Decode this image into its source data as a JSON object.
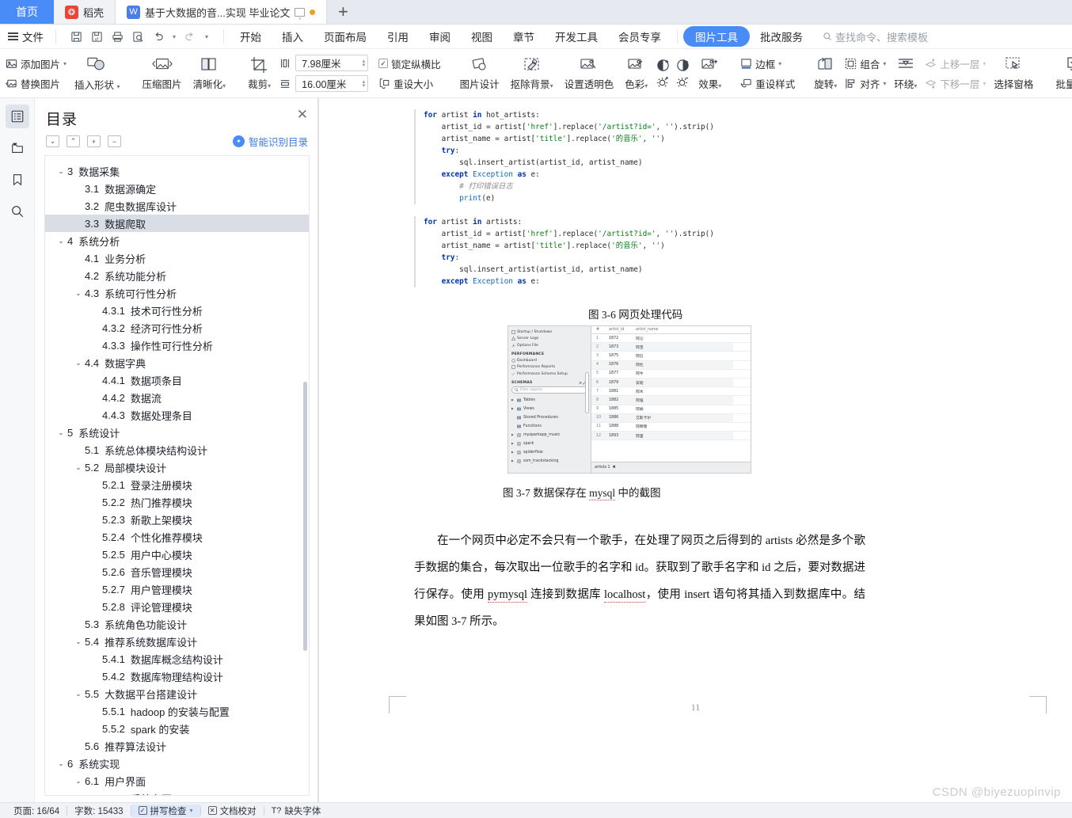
{
  "tabs": {
    "home_label": "首页",
    "docer_label": "稻壳",
    "doc_label": "基于大数据的音...实现 毕业论文",
    "new_tab_label": "+"
  },
  "menubar": {
    "file_label": "文件",
    "quick_access": [
      "save-icon",
      "save-as-icon",
      "print-icon",
      "print-preview-icon",
      "undo-icon",
      "redo-icon",
      "customize-icon"
    ],
    "items": [
      {
        "label": "开始",
        "active": false
      },
      {
        "label": "插入",
        "active": false
      },
      {
        "label": "页面布局",
        "active": false
      },
      {
        "label": "引用",
        "active": false
      },
      {
        "label": "审阅",
        "active": false
      },
      {
        "label": "视图",
        "active": false
      },
      {
        "label": "章节",
        "active": false
      },
      {
        "label": "开发工具",
        "active": false
      },
      {
        "label": "会员专享",
        "active": false
      },
      {
        "label": "图片工具",
        "active": true
      },
      {
        "label": "批改服务",
        "active": false
      }
    ],
    "search_placeholder": "查找命令、搜索模板",
    "accent_color": "#4a8cf7"
  },
  "ribbon": {
    "add_picture": "添加图片",
    "replace_picture": "替换图片",
    "insert_shape": "插入形状",
    "compress_picture": "压缩图片",
    "sharpen": "清晰化",
    "crop": "裁剪",
    "width_value": "7.98厘米",
    "height_value": "16.00厘米",
    "lock_aspect": "锁定纵横比",
    "lock_aspect_checked": true,
    "reset_size": "重设大小",
    "picture_design": "图片设计",
    "remove_background": "抠除背景",
    "set_transparent_color": "设置透明色",
    "color": "色彩",
    "brightness_up": "增加亮度",
    "brightness_down": "降低亮度",
    "effects": "效果",
    "reset_style": "重设样式",
    "border": "边框",
    "rotate": "旋转",
    "group": "组合",
    "align": "对齐",
    "wrap": "环绕",
    "bring_forward": "上移一层",
    "send_backward": "下移一层",
    "selection_pane": "选择窗格",
    "batch_process": "批量处理"
  },
  "rail": {
    "items": [
      {
        "name": "outline-icon",
        "selected": true
      },
      {
        "name": "thumbnail-icon",
        "selected": false
      },
      {
        "name": "bookmark-icon",
        "selected": false
      },
      {
        "name": "search-icon",
        "selected": false
      }
    ]
  },
  "outline": {
    "title": "目录",
    "close_label": "✕",
    "tools": [
      "expand-down",
      "collapse-up",
      "expand-all",
      "collapse-all"
    ],
    "smart_label": "智能识别目录",
    "items": [
      {
        "chev": "v",
        "num": "3",
        "text": "数据采集",
        "indent": 0,
        "hl": false
      },
      {
        "chev": "",
        "num": "3.1",
        "text": "数据源确定",
        "indent": 1,
        "hl": false
      },
      {
        "chev": "",
        "num": "3.2",
        "text": "爬虫数据库设计",
        "indent": 1,
        "hl": false
      },
      {
        "chev": "",
        "num": "3.3",
        "text": "数据爬取",
        "indent": 1,
        "hl": true
      },
      {
        "chev": "v",
        "num": "4",
        "text": "系统分析",
        "indent": 0,
        "hl": false
      },
      {
        "chev": "",
        "num": "4.1",
        "text": "业务分析",
        "indent": 1,
        "hl": false
      },
      {
        "chev": "",
        "num": "4.2",
        "text": "系统功能分析",
        "indent": 1,
        "hl": false
      },
      {
        "chev": "v",
        "num": "4.3",
        "text": "系统可行性分析",
        "indent": 1,
        "hl": false
      },
      {
        "chev": "",
        "num": "4.3.1",
        "text": "技术可行性分析",
        "indent": 2,
        "hl": false
      },
      {
        "chev": "",
        "num": "4.3.2",
        "text": "经济可行性分析",
        "indent": 2,
        "hl": false
      },
      {
        "chev": "",
        "num": "4.3.3",
        "text": "操作性可行性分析",
        "indent": 2,
        "hl": false
      },
      {
        "chev": "v",
        "num": "4.4",
        "text": "数据字典",
        "indent": 1,
        "hl": false
      },
      {
        "chev": "",
        "num": "4.4.1",
        "text": "数据项条目",
        "indent": 2,
        "hl": false
      },
      {
        "chev": "",
        "num": "4.4.2",
        "text": "数据流",
        "indent": 2,
        "hl": false
      },
      {
        "chev": "",
        "num": "4.4.3",
        "text": "数据处理条目",
        "indent": 2,
        "hl": false
      },
      {
        "chev": "v",
        "num": "5",
        "text": "系统设计",
        "indent": 0,
        "hl": false
      },
      {
        "chev": "",
        "num": "5.1",
        "text": "系统总体模块结构设计",
        "indent": 1,
        "hl": false
      },
      {
        "chev": "v",
        "num": "5.2",
        "text": "局部模块设计",
        "indent": 1,
        "hl": false
      },
      {
        "chev": "",
        "num": "5.2.1",
        "text": "登录注册模块",
        "indent": 2,
        "hl": false
      },
      {
        "chev": "",
        "num": "5.2.2",
        "text": "热门推荐模块",
        "indent": 2,
        "hl": false
      },
      {
        "chev": "",
        "num": "5.2.3",
        "text": "新歌上架模块",
        "indent": 2,
        "hl": false
      },
      {
        "chev": "",
        "num": "5.2.4",
        "text": "个性化推荐模块",
        "indent": 2,
        "hl": false
      },
      {
        "chev": "",
        "num": "5.2.5",
        "text": "用户中心模块",
        "indent": 2,
        "hl": false
      },
      {
        "chev": "",
        "num": "5.2.6",
        "text": "音乐管理模块",
        "indent": 2,
        "hl": false
      },
      {
        "chev": "",
        "num": "5.2.7",
        "text": "用户管理模块",
        "indent": 2,
        "hl": false
      },
      {
        "chev": "",
        "num": "5.2.8",
        "text": "评论管理模块",
        "indent": 2,
        "hl": false
      },
      {
        "chev": "",
        "num": "5.3",
        "text": "系统角色功能设计",
        "indent": 1,
        "hl": false
      },
      {
        "chev": "v",
        "num": "5.4",
        "text": "推荐系统数据库设计",
        "indent": 1,
        "hl": false
      },
      {
        "chev": "",
        "num": "5.4.1",
        "text": "数据库概念结构设计",
        "indent": 2,
        "hl": false
      },
      {
        "chev": "",
        "num": "5.4.2",
        "text": "数据库物理结构设计",
        "indent": 2,
        "hl": false
      },
      {
        "chev": "v",
        "num": "5.5",
        "text": "大数据平台搭建设计",
        "indent": 1,
        "hl": false
      },
      {
        "chev": "",
        "num": "5.5.1",
        "text": "hadoop 的安装与配置",
        "indent": 2,
        "hl": false
      },
      {
        "chev": "",
        "num": "5.5.2",
        "text": "spark 的安装",
        "indent": 2,
        "hl": false
      },
      {
        "chev": "",
        "num": "5.6",
        "text": "推荐算法设计",
        "indent": 1,
        "hl": false
      },
      {
        "chev": "v",
        "num": "6",
        "text": "系统实现",
        "indent": 0,
        "hl": false
      },
      {
        "chev": "v",
        "num": "6.1",
        "text": "用户界面",
        "indent": 1,
        "hl": false
      },
      {
        "chev": "",
        "num": "6.1.1",
        "text": "系统主页",
        "indent": 2,
        "hl": false
      }
    ]
  },
  "document": {
    "code_block_1": [
      "for artist in hot_artists:",
      "    artist_id = artist['href'].replace('/artist?id=', '').strip()",
      "    artist_name = artist['title'].replace('的音乐', '')",
      "    try:",
      "        sql.insert_artist(artist_id, artist_name)",
      "    except Exception as e:",
      "        # 打印错误日志",
      "        print(e)"
    ],
    "code_block_2": [
      "for artist in artists:",
      "    artist_id = artist['href'].replace('/artist?id=', '').strip()",
      "    artist_name = artist['title'].replace('的音乐', '')",
      "    try:",
      "        sql.insert_artist(artist_id, artist_name)",
      "    except Exception as e:"
    ],
    "figure_caption_1": "图 3-6 网页处理代码",
    "figure_caption_2": "图 3-7 数据保存在 mysql 中的截图",
    "paragraph": "在一个网页中必定不会只有一个歌手，在处理了网页之后得到的 artists 必然是多个歌手数据的集合，每次取出一位歌手的名字和 id。获取到了歌手名字和 id 之后，要对数据进行保存。使用 pymysql 连接到数据库 localhost，使用 insert 语句将其插入到数据库中。结果如图 3-7 所示。",
    "page_number": "11"
  },
  "screenshot": {
    "left_panel": {
      "top_items": [
        "Startup / Shutdown",
        "Server Logs",
        "Options File"
      ],
      "performance_header": "PERFORMANCE",
      "performance_items": [
        "Dashboard",
        "Performance Reports",
        "Performance Schema Setup"
      ],
      "schemas_header": "SCHEMAS",
      "filter_placeholder": "Filter objects",
      "tree": [
        "Tables",
        "Views",
        "Stored Procedures",
        "Functions",
        "mysparkapp_music",
        "spark",
        "spiderflow",
        "ssm_trackstacking"
      ]
    },
    "table": {
      "headers": [
        "#",
        "artist_id",
        "artist_name"
      ],
      "rows": [
        [
          "1",
          "1872",
          "阿沁"
        ],
        [
          "2",
          "1873",
          "阿宝"
        ],
        [
          "3",
          "1875",
          "阿信"
        ],
        [
          "4",
          "1876",
          "阿杜"
        ],
        [
          "5",
          "1877",
          "阿牛"
        ],
        [
          "6",
          "1879",
          "安琥"
        ],
        [
          "7",
          "1881",
          "阿木"
        ],
        [
          "8",
          "1882",
          "阿强"
        ],
        [
          "9",
          "1885",
          "阿娟"
        ],
        [
          "10",
          "1886",
          "艾斯卡尔"
        ],
        [
          "11",
          "1888",
          "阿穆隆"
        ],
        [
          "12",
          "1893",
          "阿里"
        ]
      ],
      "tab_label": "artists 1"
    }
  },
  "statusbar": {
    "page_label": "页面: 16/64",
    "word_count": "字数: 15433",
    "spell_check": "拼写检查",
    "proofread": "文档校对",
    "missing_font": "缺失字体"
  },
  "watermark": "CSDN @biyezuopinvip"
}
